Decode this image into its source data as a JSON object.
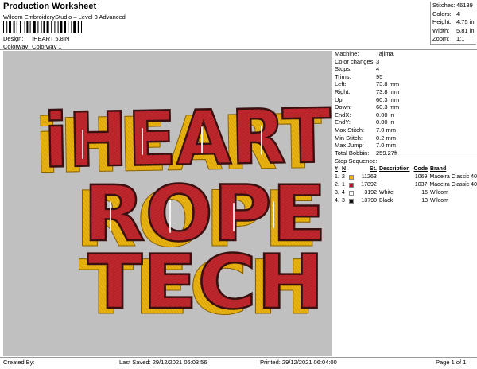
{
  "header": {
    "title": "Production Worksheet",
    "subtitle": "Wilcom EmbroideryStudio – Level 3 Advanced",
    "design_label": "Design:",
    "design_value": "IHEART 5,8IN",
    "colorway_label": "Colorway:",
    "colorway_value": "Colorway 1"
  },
  "stats": [
    {
      "label": "Stitches:",
      "value": "46139"
    },
    {
      "label": "Colors:",
      "value": "4"
    },
    {
      "label": "Height:",
      "value": "4.75 in"
    },
    {
      "label": "Width:",
      "value": "5.81 in"
    },
    {
      "label": "Zoom:",
      "value": "1:1"
    }
  ],
  "machine_info": [
    {
      "label": "Machine:",
      "value": "Tajima"
    },
    {
      "label": "Color changes:",
      "value": "3"
    },
    {
      "label": "Stops:",
      "value": "4"
    },
    {
      "label": "Trims:",
      "value": "95"
    },
    {
      "label": "Left:",
      "value": "73.8 mm"
    },
    {
      "label": "Right:",
      "value": "73.8 mm"
    },
    {
      "label": "Up:",
      "value": "60.3 mm"
    },
    {
      "label": "Down:",
      "value": "60.3 mm"
    },
    {
      "label": "EndX:",
      "value": "0.00 in"
    },
    {
      "label": "EndY:",
      "value": "0.00 in"
    },
    {
      "label": "Max Stitch:",
      "value": "7.0 mm"
    },
    {
      "label": "Min Stitch:",
      "value": "0.2 mm"
    },
    {
      "label": "Max Jump:",
      "value": "7.0 mm"
    },
    {
      "label": "Total Bobbin:",
      "value": "259.27ft"
    }
  ],
  "stop_sequence": {
    "title": "Stop Sequence:",
    "headers": {
      "num": "#",
      "n": "N",
      "st": "St.",
      "desc": "Description",
      "code": "Code",
      "brand": "Brand"
    },
    "rows": [
      {
        "num": "1.",
        "n": "2",
        "color": "#f2b400",
        "st": "11263",
        "desc": "",
        "code": "1069",
        "brand": "Madeira Classic 40"
      },
      {
        "num": "2.",
        "n": "1",
        "color": "#c8102e",
        "st": "17892",
        "desc": "",
        "code": "1037",
        "brand": "Madeira Classic 40"
      },
      {
        "num": "3.",
        "n": "4",
        "color": "#ffffff",
        "st": "3192",
        "desc": "White",
        "code": "15",
        "brand": "Wilcom"
      },
      {
        "num": "4.",
        "n": "3",
        "color": "#111111",
        "st": "13790",
        "desc": "Black",
        "code": "13",
        "brand": "Wilcom"
      }
    ]
  },
  "design_text": {
    "line1": "iHEART",
    "line2": "ROPE",
    "line3": "TECH"
  },
  "colors": {
    "red": "#c0272d",
    "gold": "#e8b311",
    "outline": "#3a1010",
    "canvas": "#c0c0c0"
  },
  "footer": {
    "created": "Created By:",
    "last_saved": "Last Saved: 29/12/2021 06:03:56",
    "printed": "Printed: 29/12/2021 06:04:00",
    "page": "Page 1 of 1"
  }
}
